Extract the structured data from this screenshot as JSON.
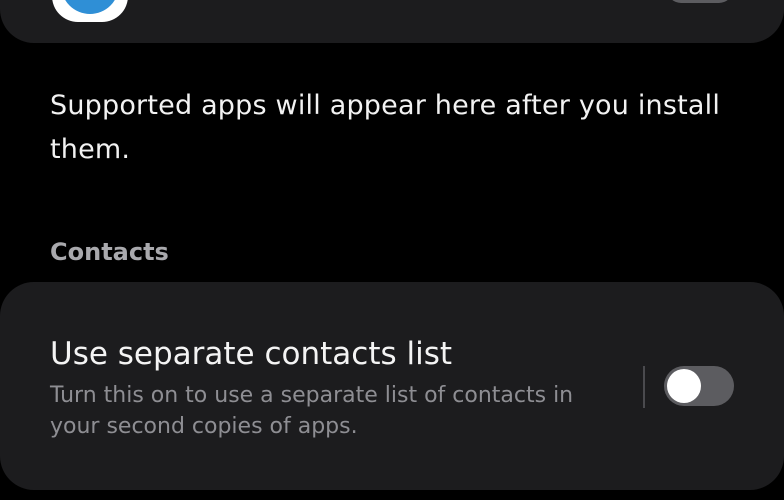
{
  "info": {
    "text": "Supported apps will appear here after you install them."
  },
  "contacts": {
    "section_header": "Contacts",
    "setting": {
      "title": "Use separate contacts list",
      "description": "Turn this on to use a separate list of contacts in your second copies of apps.",
      "enabled": false
    }
  },
  "colors": {
    "background": "#000000",
    "card": "#1c1c1e",
    "toggle_off_track": "#5c5c60",
    "app_icon_accent": "#2f8fd6"
  },
  "icons": {
    "top_app": "app-icon",
    "top_toggle": "toggle-switch"
  }
}
